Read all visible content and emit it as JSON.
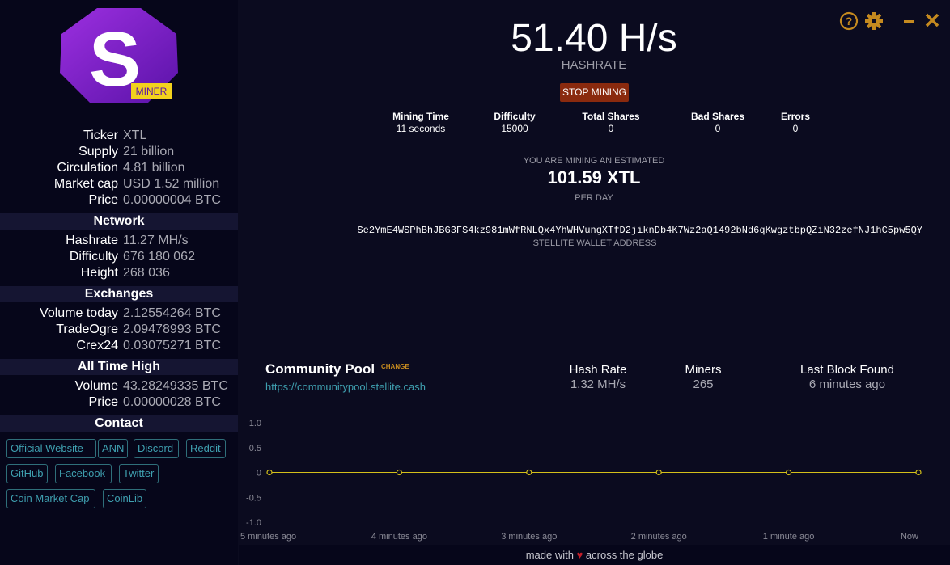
{
  "sidebar": {
    "logo_text": "S",
    "logo_badge": "MINER",
    "coin": [
      {
        "key": "Ticker",
        "value": "XTL"
      },
      {
        "key": "Supply",
        "value": "21 billion"
      },
      {
        "key": "Circulation",
        "value": "4.81 billion"
      },
      {
        "key": "Market cap",
        "value": "USD 1.52 million"
      },
      {
        "key": "Price",
        "value": "0.00000004 BTC"
      }
    ],
    "network_title": "Network",
    "network": [
      {
        "key": "Hashrate",
        "value": "11.27 MH/s"
      },
      {
        "key": "Difficulty",
        "value": "676 180 062"
      },
      {
        "key": "Height",
        "value": "268 036"
      }
    ],
    "exchanges_title": "Exchanges",
    "exchanges": [
      {
        "key": "Volume today",
        "value": "2.12554264 BTC"
      },
      {
        "key": "TradeOgre",
        "value": "2.09478993 BTC"
      },
      {
        "key": "Crex24",
        "value": "0.03075271 BTC"
      }
    ],
    "ath_title": "All Time High",
    "ath": [
      {
        "key": "Volume",
        "value": "43.28249335 BTC"
      },
      {
        "key": "Price",
        "value": "0.00000028 BTC"
      }
    ],
    "contact_title": "Contact",
    "links": [
      "Official Website",
      "ANN",
      "Discord",
      "Reddit",
      "GitHub",
      "Facebook",
      "Twitter",
      "Coin Market Cap",
      "CoinLib"
    ]
  },
  "main": {
    "hashrate_value": "51.40 H/s",
    "hashrate_label": "HASHRATE",
    "stop_button": "STOP MINING",
    "stats": [
      {
        "label": "Mining Time",
        "value": "11 seconds"
      },
      {
        "label": "Difficulty",
        "value": "15000"
      },
      {
        "label": "Total Shares",
        "value": "0"
      },
      {
        "label": "Bad Shares",
        "value": "0"
      },
      {
        "label": "Errors",
        "value": "0"
      }
    ],
    "estimate_label": "YOU ARE MINING AN ESTIMATED",
    "estimate_value": "101.59 XTL",
    "estimate_per": "PER DAY",
    "wallet_address": "Se2YmE4WSPhBhJBG3FS4kz981mWfRNLQx4YhWHVungXTfD2jiknDb4K7Wz2aQ1492bNd6qKwgztbpQZiN32zefNJ1hC5pw5QY",
    "wallet_label": "STELLITE WALLET ADDRESS"
  },
  "pool": {
    "name": "Community Pool",
    "change_label": "CHANGE",
    "url": "https://communitypool.stellite.cash",
    "stats": [
      {
        "label": "Hash Rate",
        "value": "1.32 MH/s"
      },
      {
        "label": "Miners",
        "value": "265"
      },
      {
        "label": "Last Block Found",
        "value": "6 minutes ago"
      }
    ]
  },
  "footer": {
    "before": "made with",
    "heart": "♥",
    "after": "across the globe"
  },
  "window": {
    "icons": [
      "help-icon",
      "gear-icon",
      "minimize-icon",
      "close-icon"
    ],
    "accent": "#c58a1f"
  },
  "chart_data": {
    "type": "line",
    "x": [
      "5 minutes ago",
      "4 minutes ago",
      "3 minutes ago",
      "2 minutes ago",
      "1 minute ago",
      "Now"
    ],
    "series": [
      {
        "values": [
          0,
          0,
          0,
          0,
          0,
          0
        ],
        "color": "#d4c01a"
      }
    ],
    "y_ticks": [
      "1.0",
      "0.5",
      "0",
      "-0.5",
      "-1.0"
    ],
    "ylim": [
      -1.0,
      1.0
    ],
    "grid": false
  }
}
